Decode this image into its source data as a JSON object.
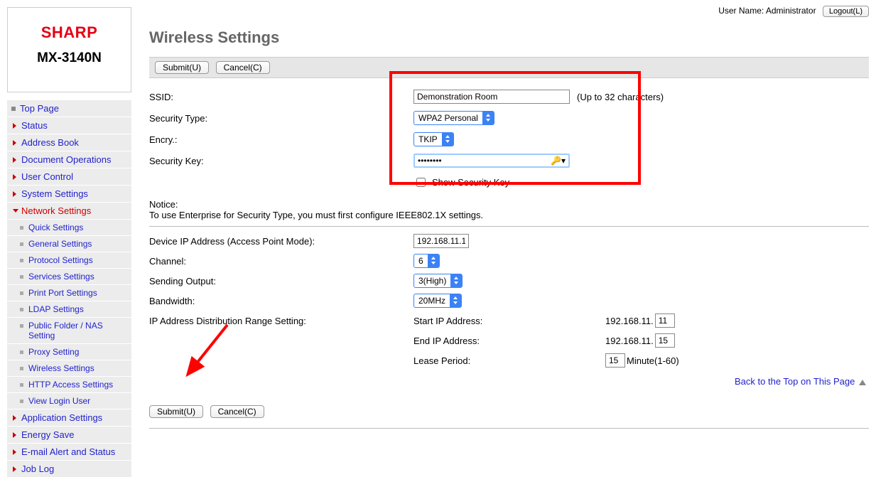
{
  "header": {
    "user_label": "User Name:",
    "user_name": "Administrator",
    "logout_label": "Logout(L)"
  },
  "brand": {
    "logo": "SHARP",
    "model": "MX-3140N"
  },
  "nav": {
    "top_page": "Top Page",
    "status": "Status",
    "address_book": "Address Book",
    "document_ops": "Document Operations",
    "user_control": "User Control",
    "system_settings": "System Settings",
    "network_settings": "Network Settings",
    "sub": {
      "quick": "Quick Settings",
      "general": "General Settings",
      "protocol": "Protocol Settings",
      "services": "Services Settings",
      "print_port": "Print Port Settings",
      "ldap": "LDAP Settings",
      "public_folder": "Public Folder / NAS Setting",
      "proxy": "Proxy Setting",
      "wireless": "Wireless Settings",
      "http": "HTTP Access Settings",
      "view_login": "View Login User"
    },
    "application_settings": "Application Settings",
    "energy_save": "Energy Save",
    "email_alert": "E-mail Alert and Status",
    "job_log": "Job Log"
  },
  "page": {
    "title": "Wireless Settings",
    "submit_label": "Submit(U)",
    "cancel_label": "Cancel(C)",
    "back_to_top": "Back to the Top on This Page"
  },
  "form": {
    "ssid_label": "SSID:",
    "ssid_value": "Demonstration Room",
    "ssid_hint": "(Up to 32 characters)",
    "security_type_label": "Security Type:",
    "security_type_value": "WPA2 Personal",
    "encry_label": "Encry.:",
    "encry_value": "TKIP",
    "security_key_label": "Security Key:",
    "security_key_value": "••••••••",
    "show_key_label": "Show Security Key",
    "notice_label": "Notice:",
    "notice_text": "To use Enterprise for Security Type, you must first configure IEEE802.1X settings."
  },
  "ap": {
    "device_ip_label": "Device IP Address (Access Point Mode):",
    "device_ip_value": "192.168.11.1",
    "channel_label": "Channel:",
    "channel_value": "6",
    "sending_output_label": "Sending Output:",
    "sending_output_value": "3(High)",
    "bandwidth_label": "Bandwidth:",
    "bandwidth_value": "20MHz",
    "ip_range_label": "IP Address Distribution Range Setting:",
    "start_ip_label": "Start IP Address:",
    "start_ip_prefix": "192.168.11.",
    "start_ip_value": "11",
    "end_ip_label": "End IP Address:",
    "end_ip_prefix": "192.168.11.",
    "end_ip_value": "15",
    "lease_label": "Lease Period:",
    "lease_value": "15",
    "lease_hint": "Minute(1-60)"
  }
}
